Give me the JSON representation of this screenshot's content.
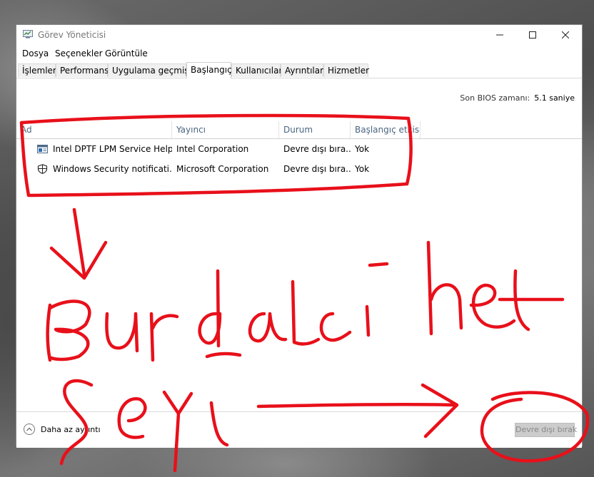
{
  "window": {
    "title": "Görev Yöneticisi",
    "controls": {
      "minimize": "—",
      "maximize": "☐",
      "close": "✕"
    }
  },
  "menu": [
    "Dosya",
    "Seçenekler",
    "Görüntüle"
  ],
  "tabs": [
    "İşlemler",
    "Performans",
    "Uygulama geçmişi",
    "Başlangıç",
    "Kullanıcılar",
    "Ayrıntılar",
    "Hizmetler"
  ],
  "active_tab": "Başlangıç",
  "bios": {
    "label": "Son BIOS zamanı:",
    "value": "5.1 saniye"
  },
  "columns": [
    "Ad",
    "Yayıncı",
    "Durum",
    "Başlangıç etkisi"
  ],
  "rows": [
    {
      "icon": "service-app-icon",
      "name": "Intel DPTF LPM Service Helper",
      "publisher": "Intel Corporation",
      "status": "Devre dışı bıra...",
      "impact": "Yok"
    },
    {
      "icon": "shield-icon",
      "name": "Windows Security notificati...",
      "publisher": "Microsoft Corporation",
      "status": "Devre dışı bıra...",
      "impact": "Yok"
    }
  ],
  "footer": {
    "fewer_details": "Daha az ayrıntı",
    "disable_button": "Devre dışı bırak"
  },
  "colors": {
    "annotation_red": "#e8101a",
    "header_text": "#4a6580"
  }
}
